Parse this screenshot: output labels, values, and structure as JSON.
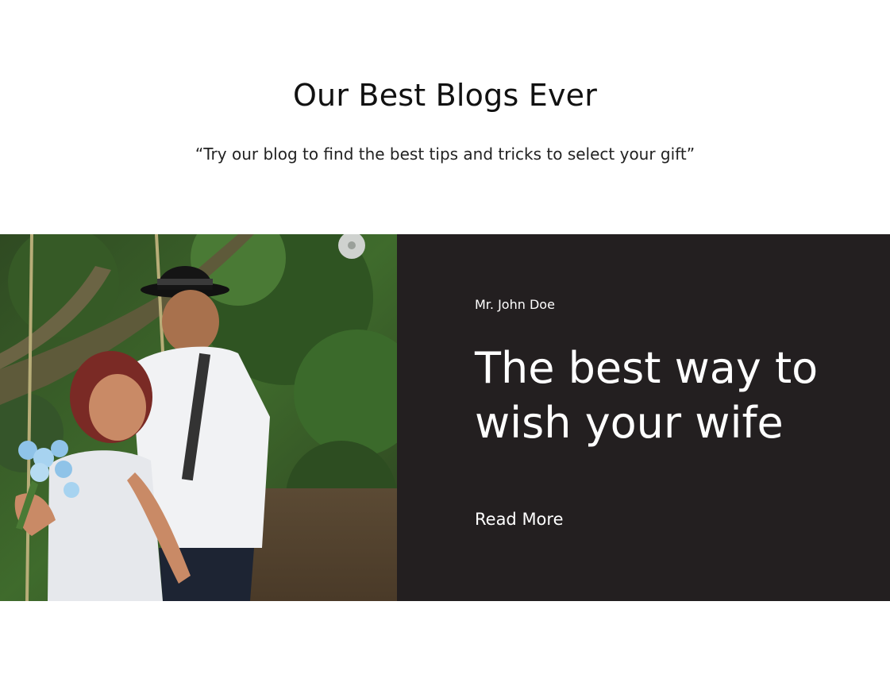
{
  "section": {
    "title": "Our Best Blogs Ever",
    "subtitle": "“Try our blog to find the best tips and tricks to select your gift”"
  },
  "blog_card": {
    "author": "Mr. John Doe",
    "headline": "The best way to wish your wife",
    "read_more_label": "Read More",
    "panel_color": "#231f20",
    "image_description_icon": "couple-photo"
  }
}
